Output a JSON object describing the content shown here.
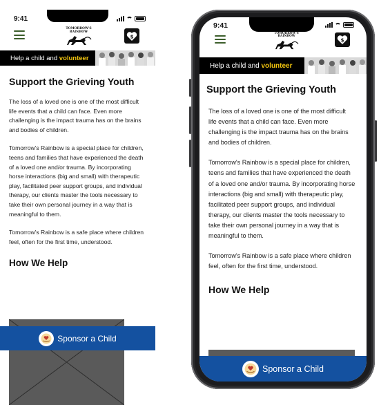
{
  "status": {
    "time": "9:41"
  },
  "header": {
    "logo_text": "TOMORROW'S RAINBOW",
    "menu_icon": "hamburger-menu-icon",
    "donate_icon": "heart-dollar-icon"
  },
  "banner": {
    "text": "Help a child and",
    "highlight": "volunteer"
  },
  "main": {
    "title": "Support the Grieving Youth",
    "paragraphs": [
      "The loss of a loved one is one of the most difficult life events that a child can face. Even more challenging is the impact trauma has on the brains and bodies of children.",
      "Tomorrow's Rainbow is a special place for children, teens and families that have experienced the death of a loved one and/or trauma. By incorporating horse interactions (big and small) with therapeutic play, facilitated peer support groups, and individual therapy, our clients master the tools necessary to take their own personal journey in a way that is meaningful to them.",
      "Tomorrow's Rainbow is a safe place where children feel, often for the first time, understood."
    ],
    "section_heading": "How We Help"
  },
  "sponsor": {
    "label": "Sponsor a Child",
    "icon": "hand-heart-icon"
  },
  "colors": {
    "banner_bg": "#000000",
    "highlight": "#f1c40f",
    "sponsor_bg": "#1451a0",
    "menu_icon": "#3b5d2a"
  }
}
